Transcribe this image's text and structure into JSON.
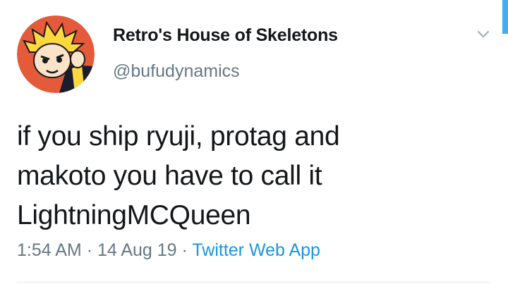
{
  "tweet": {
    "author": {
      "display_name": "Retro's House of Skeletons",
      "username": "@bufudynamics"
    },
    "text_lines": [
      "if you ship ryuji, protag and",
      "makoto you have to call it",
      "LightningMCQueen"
    ],
    "meta": {
      "time": "1:54 AM",
      "separator": "·",
      "date": "14 Aug 19",
      "source": "Twitter Web App"
    },
    "menu_icon": "chevron-down-icon",
    "avatar_icon": "profile-avatar"
  },
  "colors": {
    "text_primary": "#14171a",
    "text_secondary": "#657786",
    "link": "#1b95e0",
    "avatar_bg": "#e45a3a"
  }
}
